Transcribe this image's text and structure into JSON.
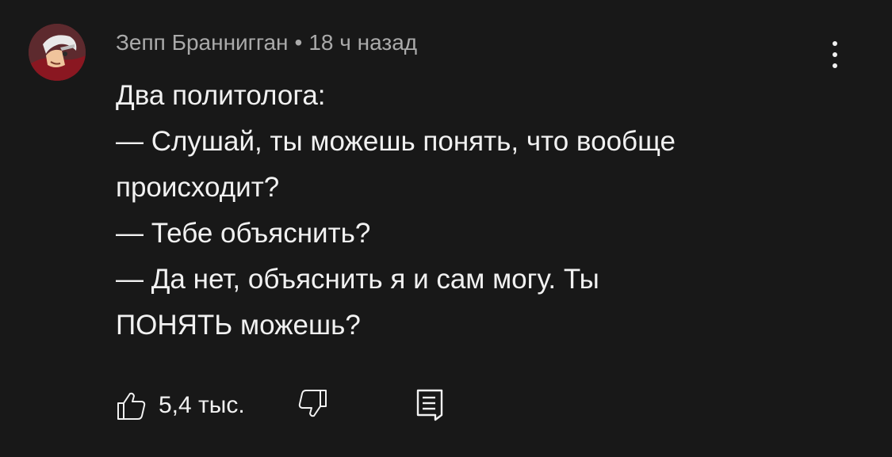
{
  "comment": {
    "author": "Зепп Браннигган",
    "separator": "•",
    "time": "18 ч назад",
    "lines": [
      "Два политолога:",
      "— Слушай, ты можешь понять, что вообще",
      "происходит?",
      "— Тебе объяснить?",
      "— Да нет, объяснить я и сам могу. Ты",
      "ПОНЯТЬ можешь?"
    ],
    "likes": "5,4 тыс.",
    "icons": {
      "avatar": "avatar-icon",
      "menu": "more-vertical-icon",
      "like": "thumbs-up-icon",
      "dislike": "thumbs-down-icon",
      "reply": "reply-comment-icon"
    },
    "colors": {
      "background": "#181818",
      "text": "#f1f1f1",
      "meta": "#aaaaaa"
    }
  }
}
